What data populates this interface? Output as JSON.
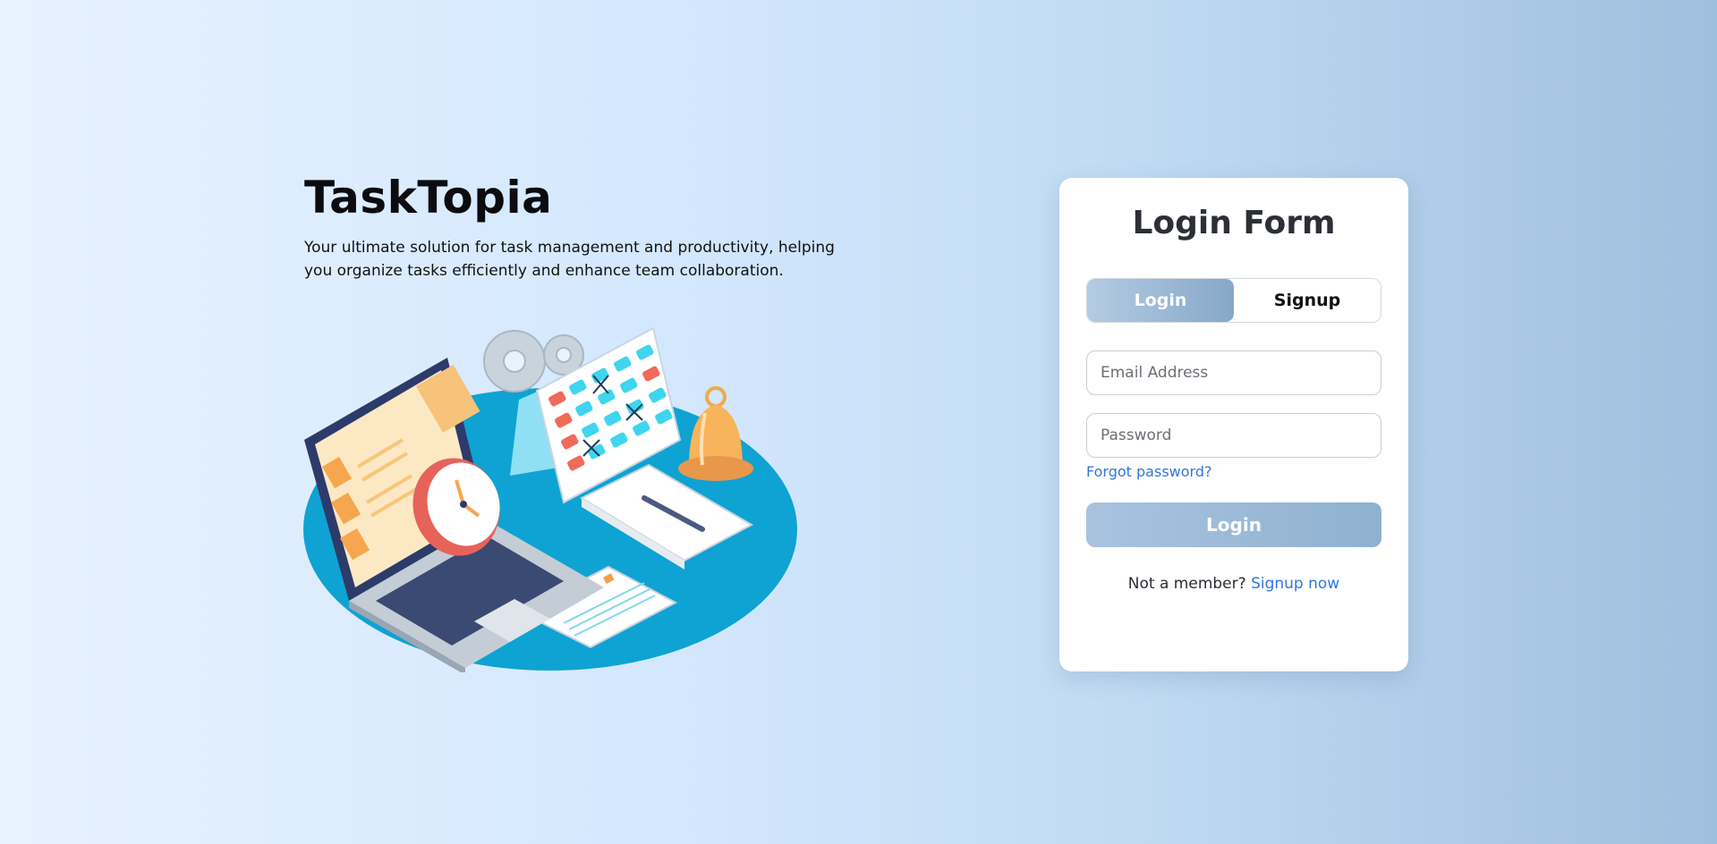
{
  "brand": {
    "title": "TaskTopia",
    "tagline": "Your ultimate solution for task management and productivity, helping you organize tasks efficiently and enhance team collaboration."
  },
  "illustration": {
    "icon": "task-management-illustration"
  },
  "login_card": {
    "title": "Login Form",
    "tabs": {
      "login_label": "Login",
      "signup_label": "Signup",
      "active": "Login"
    },
    "email": {
      "placeholder": "Email Address",
      "value": ""
    },
    "password": {
      "placeholder": "Password",
      "value": ""
    },
    "forgot_label": "Forgot password?",
    "submit_label": "Login",
    "footer": {
      "prompt": "Not a member?",
      "link_label": "Signup now"
    }
  },
  "colors": {
    "accent_link": "#2f76e0",
    "button_gradient_start": "#a9c3df",
    "button_gradient_end": "#8fb1d0",
    "card_bg": "#ffffff"
  }
}
